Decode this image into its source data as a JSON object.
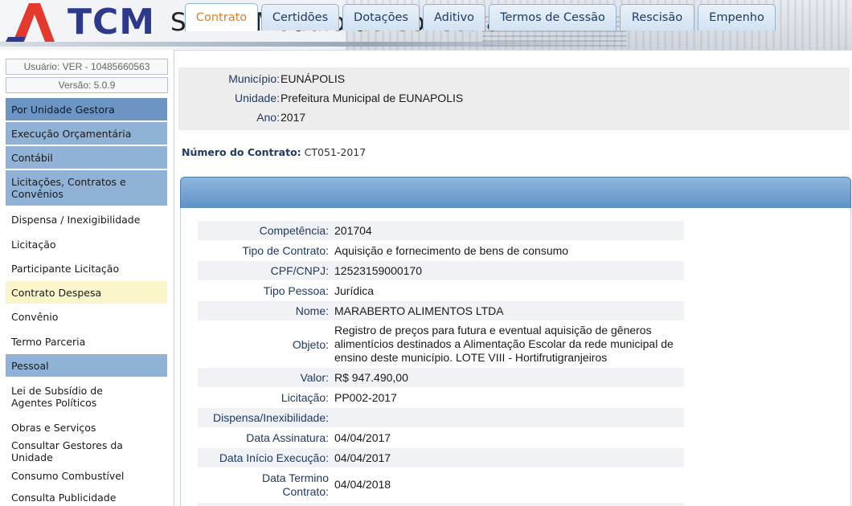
{
  "header": {
    "logo_text": "TCM",
    "app_title": "SIGA - Módulo de Consulta"
  },
  "sidebar": {
    "user_label": "Usuário: VER - 10485660563",
    "version_label": "Versão: 5.0.9",
    "items": [
      {
        "label": "Por Unidade Gestora"
      },
      {
        "label": "Execução Orçamentária"
      },
      {
        "label": "Contábil"
      },
      {
        "label": "Licitações, Contratos e Convênios"
      },
      {
        "label": "Dispensa / Inexigibilidade"
      },
      {
        "label": "Licitação"
      },
      {
        "label": "Participante Licitação"
      },
      {
        "label": "Contrato Despesa"
      },
      {
        "label": "Convênio"
      },
      {
        "label": "Termo Parceria"
      },
      {
        "label": "Pessoal"
      },
      {
        "label": "Lei de Subsídio de Agentes Políticos"
      },
      {
        "label": "Obras e Serviços"
      },
      {
        "label": "Consultar Gestores da Unidade"
      },
      {
        "label": "Consumo Combustível"
      },
      {
        "label": "Consulta Publicidade"
      }
    ]
  },
  "entity": {
    "municipio_label": "Município:",
    "municipio_value": "EUNÁPOLIS",
    "unidade_label": "Unidade:",
    "unidade_value": "Prefeitura Municipal de EUNAPOLIS",
    "ano_label": "Ano:",
    "ano_value": "2017"
  },
  "contract": {
    "number_label": "Número do Contrato:",
    "number_value": "CT051-2017"
  },
  "tabs": [
    {
      "label": "Contrato"
    },
    {
      "label": "Certidões"
    },
    {
      "label": "Dotações"
    },
    {
      "label": "Aditivo"
    },
    {
      "label": "Termos de Cessão"
    },
    {
      "label": "Rescisão"
    },
    {
      "label": "Empenho"
    }
  ],
  "fields": [
    {
      "label": "Competência:",
      "value": "201704"
    },
    {
      "label": "Tipo de Contrato:",
      "value": "Aquisição e fornecimento de bens de consumo"
    },
    {
      "label": "CPF/CNPJ:",
      "value": "12523159000170"
    },
    {
      "label": "Tipo Pessoa:",
      "value": "Jurídica"
    },
    {
      "label": "Nome:",
      "value": "MARABERTO ALIMENTOS LTDA"
    },
    {
      "label": "Objeto:",
      "value": "Registro de preços para futura e eventual aquisição de gêneros alimentícios destinados a Alimentação Escolar da rede municipal de ensino deste município. LOTE VIII - Hortifrutigranjeiros"
    },
    {
      "label": "Valor:",
      "value": "R$ 947.490,00"
    },
    {
      "label": "Licitação:",
      "value": "PP002-2017"
    },
    {
      "label": "Dispensa/Inexibilidade:",
      "value": ""
    },
    {
      "label": "Data Assinatura:",
      "value": "04/04/2017"
    },
    {
      "label": "Data Início Execução:",
      "value": "04/04/2017"
    },
    {
      "label": "Data Termino Contrato:",
      "value": "04/04/2018"
    }
  ],
  "colors": {
    "accent_active_tab_text": "#e0802a",
    "label_blue": "#1f3a66",
    "menu_category": "#8fb2d6",
    "menu_active": "#fbf6c9",
    "logo_red": "#e23b2e"
  }
}
